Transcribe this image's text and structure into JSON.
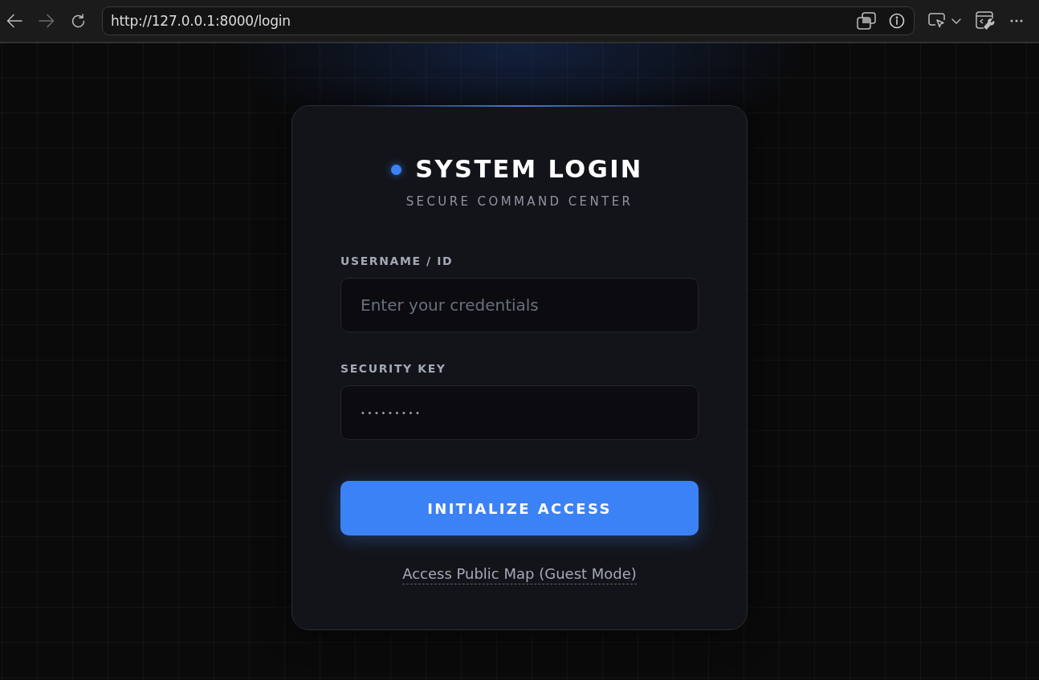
{
  "browser": {
    "forward_disabled": true,
    "url": "http://127.0.0.1:8000/login"
  },
  "login": {
    "title": "SYSTEM LOGIN",
    "subtitle": "SECURE COMMAND CENTER",
    "fields": [
      {
        "kind": "text",
        "label": "USERNAME / ID",
        "placeholder": "Enter your credentials"
      },
      {
        "kind": "password",
        "label": "SECURITY KEY",
        "value": "•••••••••"
      }
    ],
    "submit_button": "INITIALIZE ACCESS",
    "guest_link": "Access Public Map (Guest Mode)"
  }
}
